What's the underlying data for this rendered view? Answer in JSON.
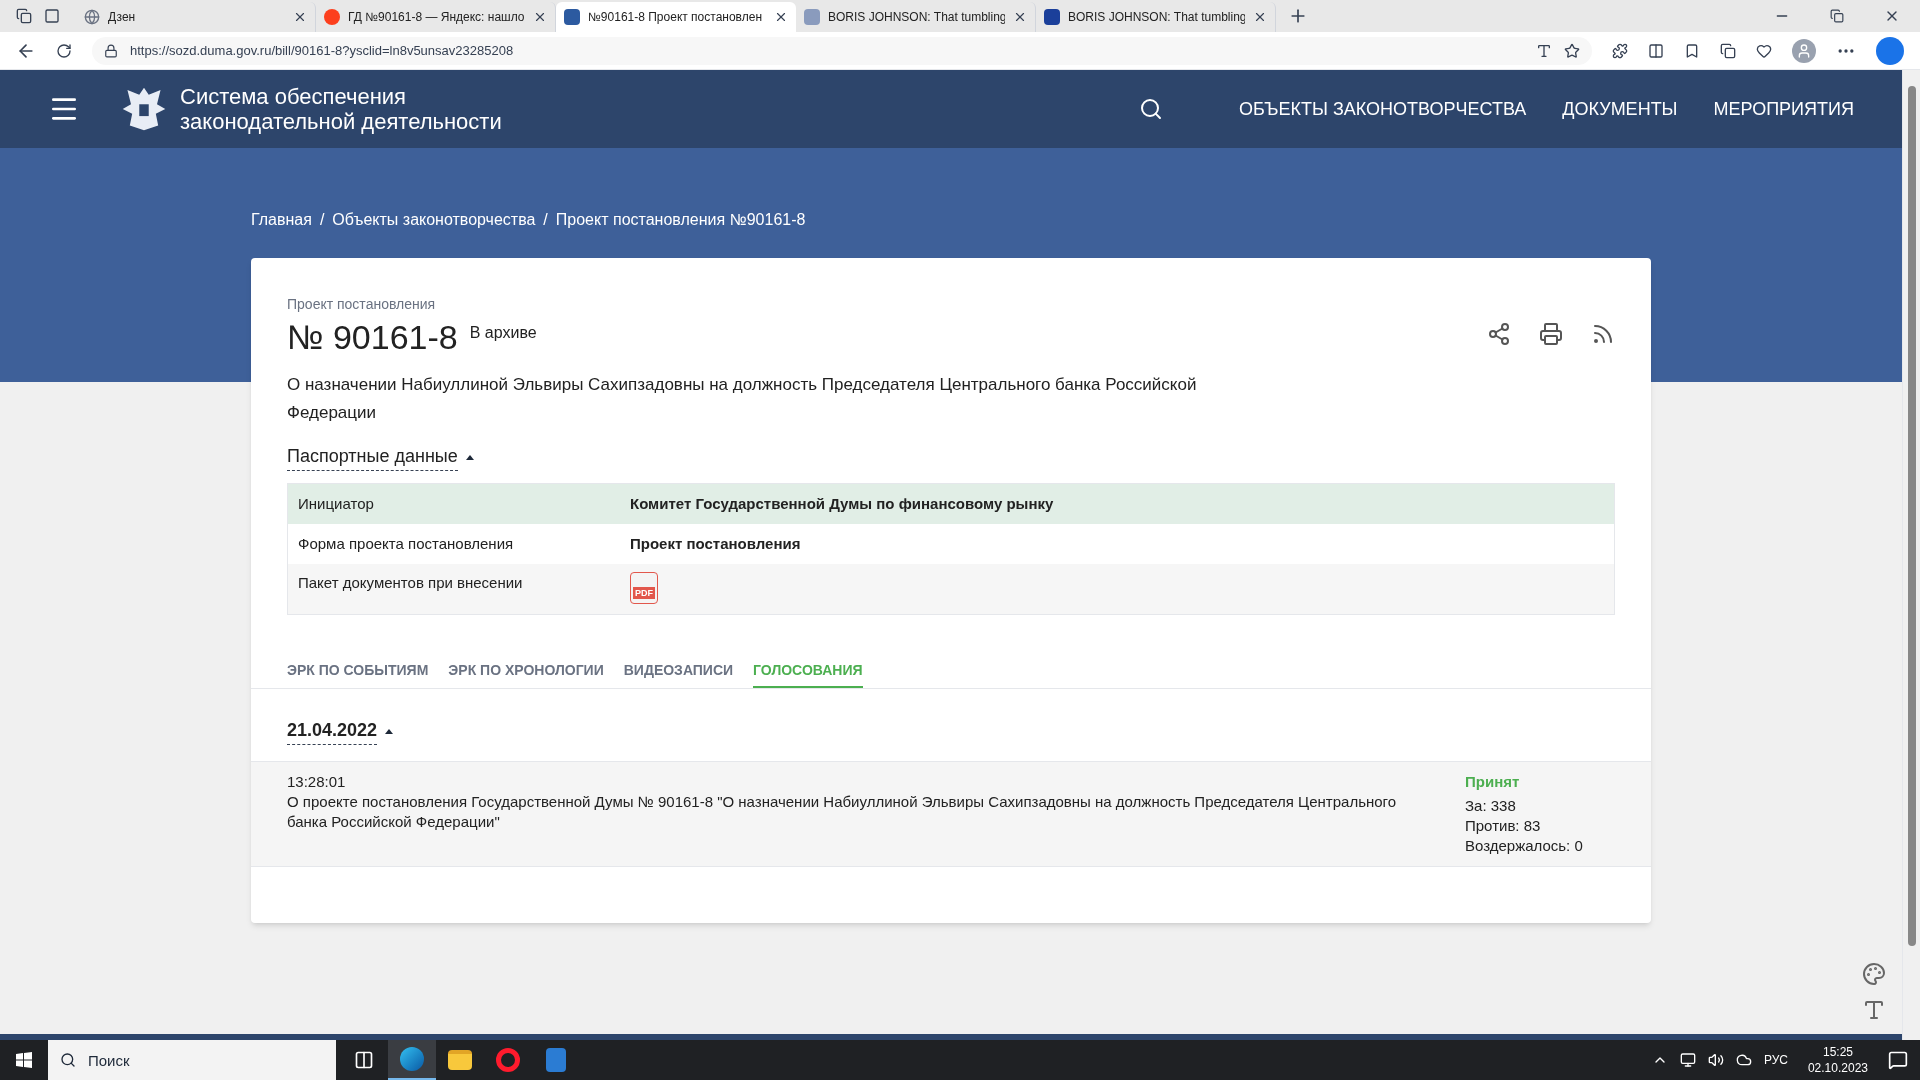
{
  "browser": {
    "tabs": [
      {
        "title": "Дзен",
        "kind": "globe",
        "selected": false
      },
      {
        "title": "ГД №90161-8 — Яндекс: нашло",
        "kind": "yandex",
        "selected": false
      },
      {
        "title": "№90161-8 Проект постановлен",
        "kind": "site",
        "selected": true
      },
      {
        "title": "BORIS JOHNSON: That tumbling",
        "kind": "m-grey",
        "selected": false
      },
      {
        "title": "BORIS JOHNSON: That tumbling",
        "kind": "m-blue",
        "selected": false
      }
    ],
    "url": "https://sozd.duma.gov.ru/bill/90161-8?ysclid=ln8v5unsav23285208"
  },
  "site": {
    "title_lines": [
      "Система обеспечения",
      "законодательной деятельности"
    ],
    "nav": [
      "ОБЪЕКТЫ ЗАКОНОТВОРЧЕСТВА",
      "ДОКУМЕНТЫ",
      "МЕРОПРИЯТИЯ"
    ]
  },
  "breadcrumbs": [
    {
      "label": "Главная",
      "separator": "/"
    },
    {
      "label": "Объекты законотворчества",
      "separator": "/"
    },
    {
      "label": "Проект постановления №90161-8"
    }
  ],
  "bill": {
    "type_label": "Проект постановления",
    "number": "№ 90161-8",
    "status": "В архиве",
    "title": "О назначении Набиуллиной Эльвиры Сахипзадовны на должность Председателя Центрального банка Российской Федерации"
  },
  "passport": {
    "heading": "Паспортные данные",
    "expanded": true,
    "rows": [
      {
        "kind": "text",
        "label": "Инициатор",
        "value": "Комитет Государственной Думы по финансовому рынку",
        "highlighted": true
      },
      {
        "kind": "text",
        "label": "Форма проекта постановления",
        "value": "Проект постановления",
        "highlighted": false
      },
      {
        "kind": "pdf",
        "label": "Пакет документов при внесении",
        "value": "PDF",
        "highlighted": false
      }
    ]
  },
  "tabs": [
    {
      "label": "ЭРК ПО СОБЫТИЯМ",
      "selected": false
    },
    {
      "label": "ЭРК ПО ХРОНОЛОГИИ",
      "selected": false
    },
    {
      "label": "ВИДЕОЗАПИСИ",
      "selected": false
    },
    {
      "label": "ГОЛОСОВАНИЯ",
      "selected": true
    }
  ],
  "votes": {
    "date": "21.04.2022",
    "expanded": true,
    "items": [
      {
        "time": "13:28:01",
        "text": "О проекте постановления Государственной Думы № 90161-8 \"О назначении Набиуллиной Эльвиры Сахипзадовны на должность Председателя Центрального банка Российской Федерации\"",
        "result": "Принят",
        "counts": [
          "За: 338",
          "Против: 83",
          "Воздержалось: 0"
        ]
      }
    ]
  },
  "taskbar": {
    "search_placeholder": "Поиск",
    "apps": [
      {
        "kind": "taskview",
        "active": false
      },
      {
        "kind": "edge",
        "active": true
      },
      {
        "kind": "explorer",
        "active": false
      },
      {
        "kind": "opera",
        "active": false
      },
      {
        "kind": "doc",
        "active": false
      }
    ],
    "language": "РУС",
    "time": "15:25",
    "date": "02.10.2023"
  }
}
